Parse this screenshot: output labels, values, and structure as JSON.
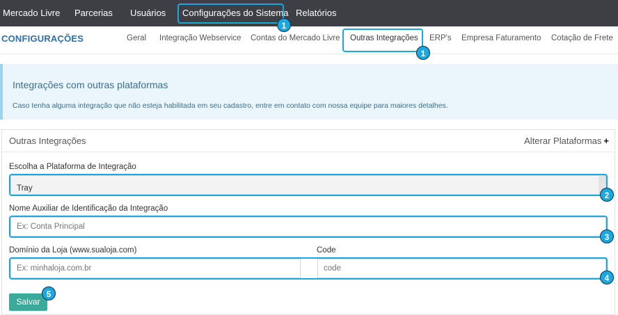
{
  "topnav": {
    "items": [
      "Mercado Livre",
      "Parcerias",
      "Usuários",
      "Configurações do Sistema",
      "Relatórios"
    ]
  },
  "subnav": {
    "brand": "CONFIGURAÇÕES",
    "tabs": [
      "Geral",
      "Integração Webservice",
      "Contas do Mercado Livre",
      "Outras Integrações",
      "ERP's",
      "Empresa Faturamento",
      "Cotação de Frete"
    ]
  },
  "info": {
    "title": "Integrações com outras plataformas",
    "description": "Caso tenha alguma integração que não esteja habilitada em seu cadastro, entre em contato com nossa equipe para maiores detalhes."
  },
  "panel": {
    "title": "Outras Integrações",
    "action": "Alterar Plataformas",
    "platform_label": "Escolha a Plataforma de Integração",
    "platform_value": "Tray",
    "name_label": "Nome Auxiliar de Identificação da Integração",
    "name_placeholder": "Ex: Conta Principal",
    "domain_label": "Domínio da Loja (www.sualoja.com)",
    "domain_placeholder": "Ex: minhaloja.com.br",
    "code_label": "Code",
    "code_placeholder": "code",
    "save_label": "Salvar"
  },
  "badges": [
    "1",
    "1",
    "2",
    "3",
    "4",
    "5"
  ],
  "colors": {
    "highlight": "#1aa8df",
    "save": "#3aab9a",
    "topbar": "#3d3f45",
    "brand": "#2f6fa8"
  }
}
